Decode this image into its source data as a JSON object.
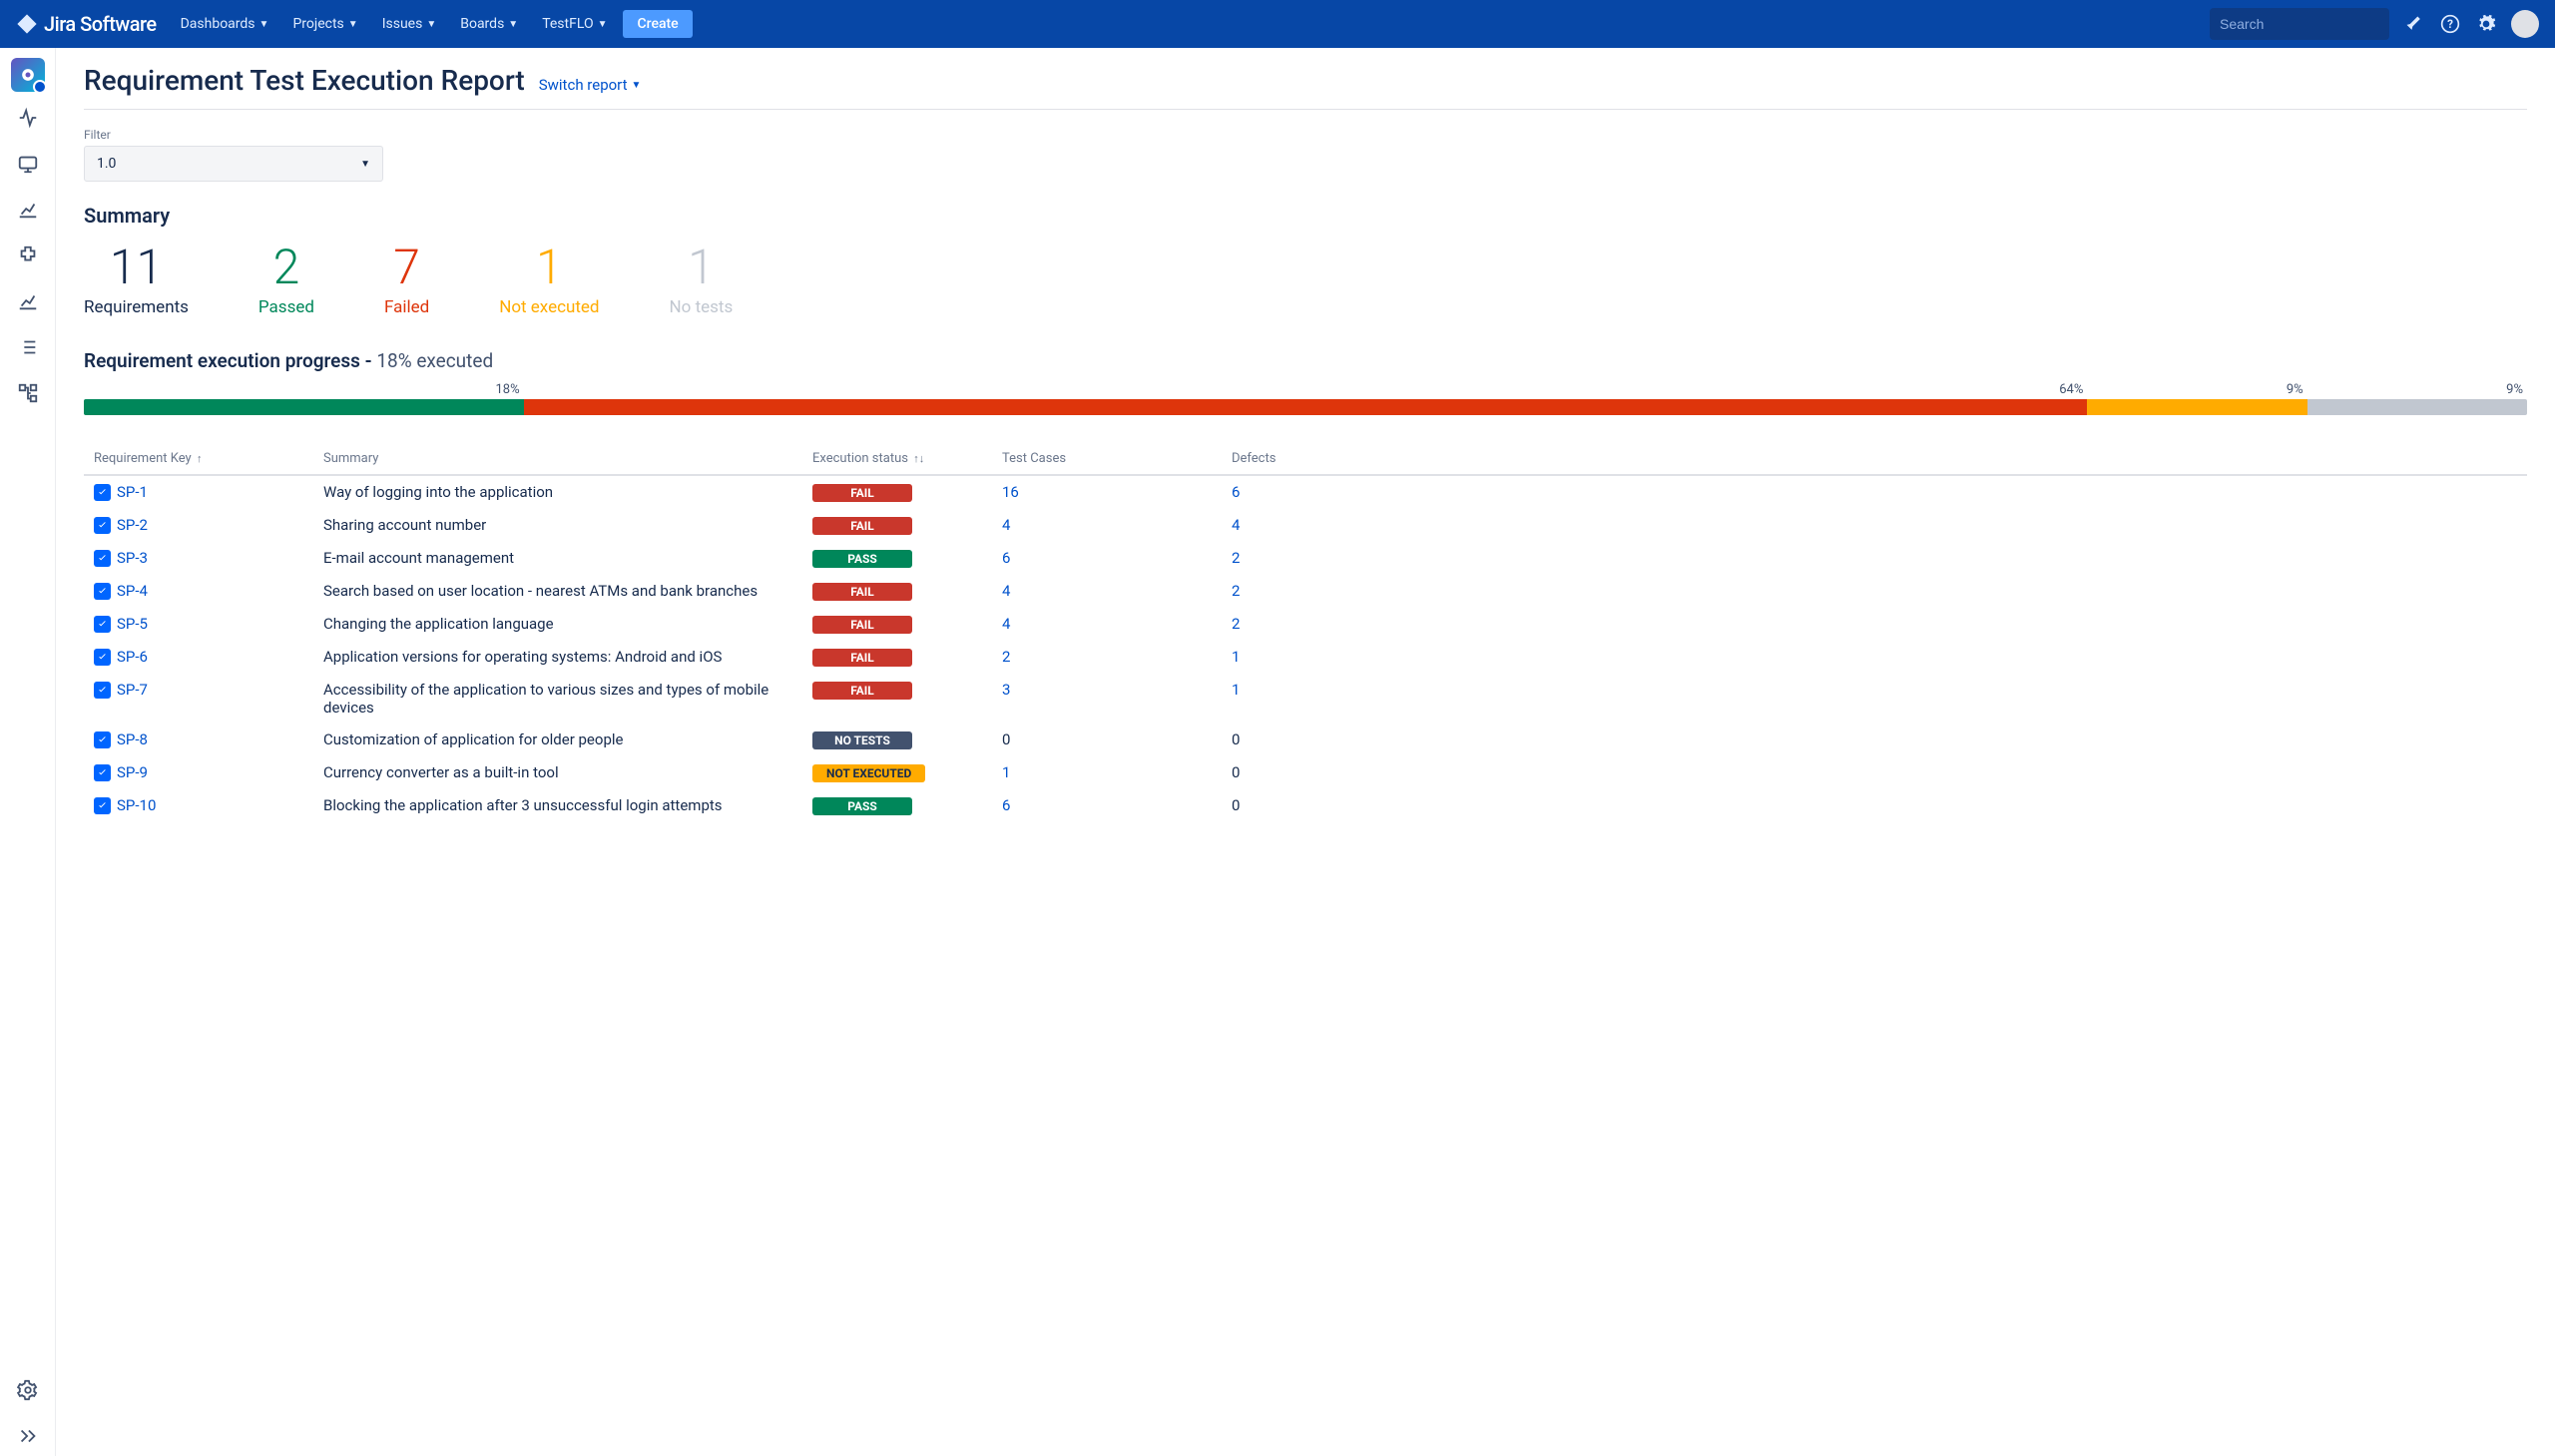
{
  "nav": {
    "logo_text": "Jira Software",
    "items": [
      "Dashboards",
      "Projects",
      "Issues",
      "Boards",
      "TestFLO"
    ],
    "create": "Create",
    "search_placeholder": "Search"
  },
  "page": {
    "title": "Requirement Test Execution Report",
    "switch_report": "Switch report"
  },
  "filter": {
    "label": "Filter",
    "value": "1.0"
  },
  "summary": {
    "title": "Summary",
    "items": [
      {
        "value": "11",
        "label": "Requirements",
        "color": "c-black"
      },
      {
        "value": "2",
        "label": "Passed",
        "color": "c-green"
      },
      {
        "value": "7",
        "label": "Failed",
        "color": "c-red"
      },
      {
        "value": "1",
        "label": "Not executed",
        "color": "c-amber"
      },
      {
        "value": "1",
        "label": "No tests",
        "color": "c-gray"
      }
    ]
  },
  "progress": {
    "title_prefix": "Requirement execution progress - ",
    "executed_text": "18% executed",
    "segments": [
      {
        "pct": 18,
        "label": "18%",
        "class": "seg-green"
      },
      {
        "pct": 64,
        "label": "64%",
        "class": "seg-red"
      },
      {
        "pct": 9,
        "label": "9%",
        "class": "seg-amber"
      },
      {
        "pct": 9,
        "label": "9%",
        "class": "seg-gray"
      }
    ]
  },
  "table": {
    "headers": {
      "key": "Requirement Key",
      "summary": "Summary",
      "exec": "Execution status",
      "tests": "Test Cases",
      "defects": "Defects"
    },
    "rows": [
      {
        "key": "SP-1",
        "summary": "Way of logging into the application",
        "status": "FAIL",
        "status_class": "st-fail",
        "tests": "16",
        "tests_link": true,
        "defects": "6",
        "defects_link": true
      },
      {
        "key": "SP-2",
        "summary": "Sharing account number",
        "status": "FAIL",
        "status_class": "st-fail",
        "tests": "4",
        "tests_link": true,
        "defects": "4",
        "defects_link": true
      },
      {
        "key": "SP-3",
        "summary": "E-mail account management",
        "status": "PASS",
        "status_class": "st-pass",
        "tests": "6",
        "tests_link": true,
        "defects": "2",
        "defects_link": true
      },
      {
        "key": "SP-4",
        "summary": "Search based on user location - nearest ATMs and bank branches",
        "status": "FAIL",
        "status_class": "st-fail",
        "tests": "4",
        "tests_link": true,
        "defects": "2",
        "defects_link": true
      },
      {
        "key": "SP-5",
        "summary": "Changing the application language",
        "status": "FAIL",
        "status_class": "st-fail",
        "tests": "4",
        "tests_link": true,
        "defects": "2",
        "defects_link": true
      },
      {
        "key": "SP-6",
        "summary": "Application versions for operating systems: Android and iOS",
        "status": "FAIL",
        "status_class": "st-fail",
        "tests": "2",
        "tests_link": true,
        "defects": "1",
        "defects_link": true
      },
      {
        "key": "SP-7",
        "summary": "Accessibility of the application to various sizes and types of mobile devices",
        "status": "FAIL",
        "status_class": "st-fail",
        "tests": "3",
        "tests_link": true,
        "defects": "1",
        "defects_link": true
      },
      {
        "key": "SP-8",
        "summary": "Customization of application for older people",
        "status": "NO TESTS",
        "status_class": "st-notests",
        "tests": "0",
        "tests_link": false,
        "defects": "0",
        "defects_link": false
      },
      {
        "key": "SP-9",
        "summary": "Currency converter as a built-in tool",
        "status": "NOT EXECUTED",
        "status_class": "st-notexec",
        "tests": "1",
        "tests_link": true,
        "defects": "0",
        "defects_link": false
      },
      {
        "key": "SP-10",
        "summary": "Blocking the application after 3 unsuccessful login attempts",
        "status": "PASS",
        "status_class": "st-pass",
        "tests": "6",
        "tests_link": true,
        "defects": "0",
        "defects_link": false
      }
    ]
  },
  "chart_data": {
    "type": "bar",
    "title": "Requirement execution progress",
    "categories": [
      "Passed",
      "Failed",
      "Not executed",
      "No tests"
    ],
    "values": [
      18,
      64,
      9,
      9
    ],
    "ylabel": "percent",
    "ylim": [
      0,
      100
    ]
  }
}
